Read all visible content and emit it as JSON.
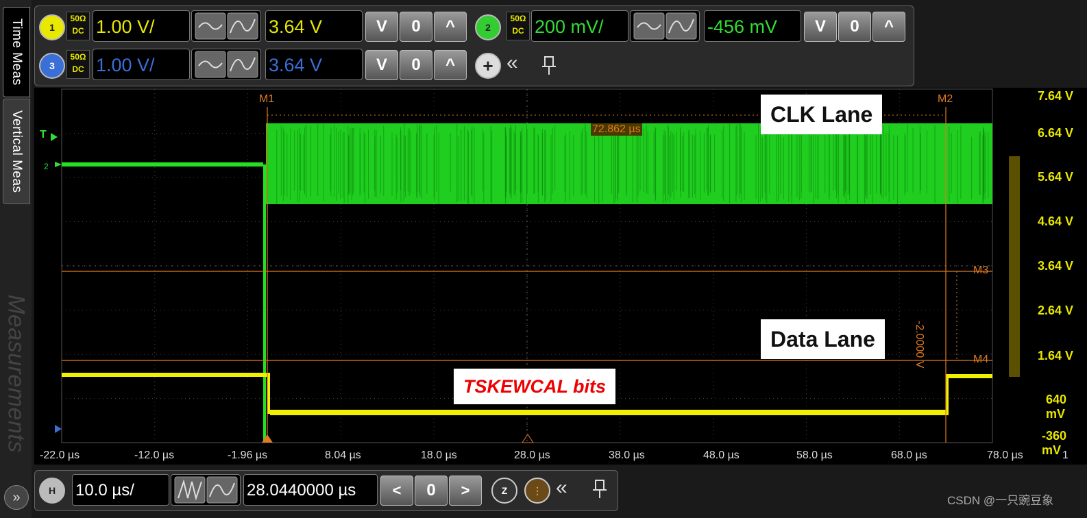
{
  "side_tabs": {
    "time_meas": "Time Meas",
    "vertical_meas": "Vertical Meas",
    "measurements": "Measurements",
    "expand": "»"
  },
  "channels": [
    {
      "num": "1",
      "impedance": "50Ω",
      "coupling": "DC",
      "scale": "1.00 V/",
      "offset": "3.64 V",
      "color": "#e8e800"
    },
    {
      "num": "2",
      "impedance": "50Ω",
      "coupling": "DC",
      "scale": "200 mV/",
      "offset": "-456 mV",
      "color": "#33cc33"
    },
    {
      "num": "3",
      "impedance": "50Ω",
      "coupling": "DC",
      "scale": "1.00 V/",
      "offset": "3.64 V",
      "color": "#3a6fd8"
    }
  ],
  "toolbar_icons": {
    "down": "V",
    "zero": "0",
    "up": "^",
    "add": "+",
    "collapse": "«",
    "pin": "pin-icon"
  },
  "markers": {
    "m1": "M1",
    "m2": "M2",
    "m3": "M3",
    "m4": "M4",
    "delta_t": "72.862 µs",
    "delta_v": "-2.0000 V"
  },
  "trigger_label": "T",
  "ground_label": "2",
  "volt_scale": [
    "7.64 V",
    "6.64 V",
    "5.64 V",
    "4.64 V",
    "3.64 V",
    "2.64 V",
    "1.64 V",
    "640 mV",
    "-360 mV"
  ],
  "time_scale": [
    "-22.0 µs",
    "-12.0 µs",
    "-1.96 µs",
    "8.04 µs",
    "18.0 µs",
    "28.0 µs",
    "38.0 µs",
    "48.0 µs",
    "58.0 µs",
    "68.0 µs",
    "78.0 µs"
  ],
  "time_scale_right": "1",
  "annotations": {
    "clk_lane": "CLK Lane",
    "data_lane": "Data Lane",
    "tskewcal": "TSKEWCAL bits"
  },
  "horizontal": {
    "label": "H",
    "scale": "10.0 µs/",
    "position": "28.0440000 µs"
  },
  "watermark": "CSDN @一只豌豆象",
  "colors": {
    "clk_trace": "#22e022",
    "data_trace": "#f0f000",
    "marker": "#e07a20",
    "grid": "#444444"
  }
}
